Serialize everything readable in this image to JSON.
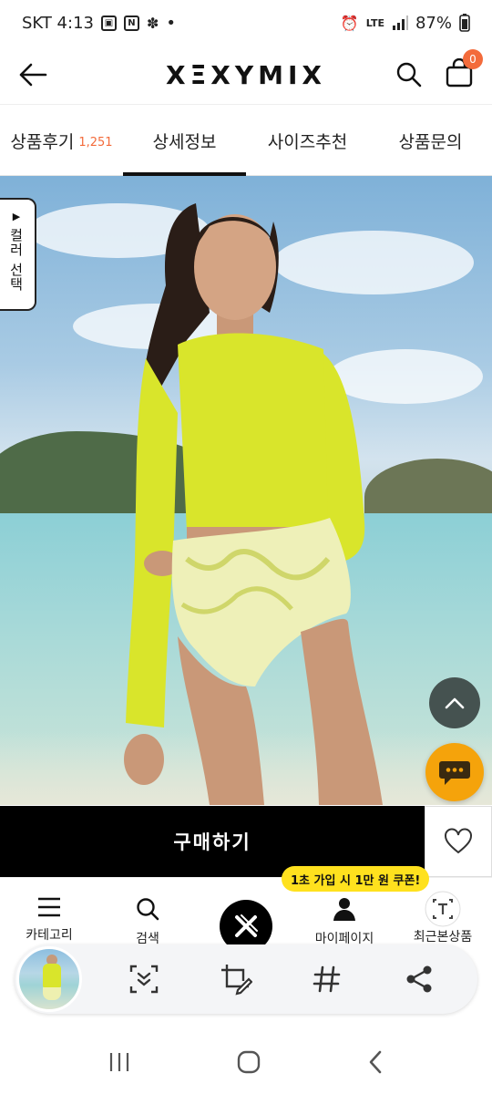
{
  "status_bar": {
    "carrier_time": "SKT 4:13",
    "dot": "•",
    "network": "LTE",
    "battery": "87%"
  },
  "header": {
    "logo": "XΞXYMIX",
    "cart_count": "0"
  },
  "tabs": [
    {
      "label": "상품후기",
      "count": "1,251"
    },
    {
      "label": "상세정보",
      "count": ""
    },
    {
      "label": "사이즈추천",
      "count": ""
    },
    {
      "label": "상품문의",
      "count": ""
    }
  ],
  "hero": {
    "color_select_label": "컬러 선택"
  },
  "buy": {
    "label": "구매하기"
  },
  "coupon": "1초 가입 시 1만 원 쿠폰!",
  "bottom_nav": [
    {
      "label": "카테고리",
      "icon": "menu-icon"
    },
    {
      "label": "검색",
      "icon": "search-icon"
    },
    {
      "label": "",
      "icon": "xexymix-logo-icon"
    },
    {
      "label": "마이페이지",
      "icon": "user-icon"
    },
    {
      "label": "최근본상품",
      "icon": "text-recognize-icon"
    }
  ],
  "colors": {
    "accent_orange": "#f36b3b",
    "chat_yellow": "#f5a30b",
    "coupon_yellow": "#ffe11e",
    "swim_top": "#d9e52b"
  }
}
